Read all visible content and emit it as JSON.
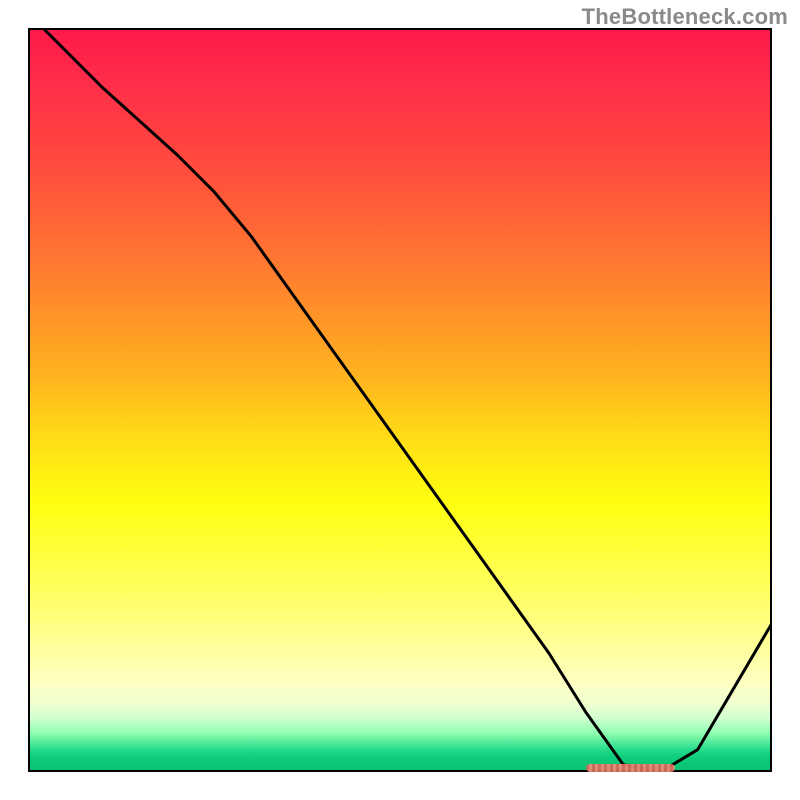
{
  "watermark": "TheBottleneck.com",
  "chart_data": {
    "type": "line",
    "title": "",
    "xlabel": "",
    "ylabel": "",
    "xlim": [
      0,
      100
    ],
    "ylim": [
      0,
      100
    ],
    "x": [
      2,
      10,
      20,
      25,
      30,
      40,
      50,
      60,
      70,
      75,
      80,
      85,
      90,
      100
    ],
    "values": [
      100,
      92,
      83,
      78,
      72,
      58,
      44,
      30,
      16,
      8,
      1,
      0,
      3,
      20
    ],
    "gradient_stops": [
      {
        "pct": 0,
        "color": "#ff1a4a"
      },
      {
        "pct": 6,
        "color": "#ff2a4a"
      },
      {
        "pct": 18,
        "color": "#ff4a3e"
      },
      {
        "pct": 32,
        "color": "#ff7a30"
      },
      {
        "pct": 46,
        "color": "#ffb020"
      },
      {
        "pct": 56,
        "color": "#ffe015"
      },
      {
        "pct": 64,
        "color": "#ffff10"
      },
      {
        "pct": 78,
        "color": "#ffff70"
      },
      {
        "pct": 88,
        "color": "#ffffc0"
      },
      {
        "pct": 91,
        "color": "#f0ffd0"
      },
      {
        "pct": 93,
        "color": "#d0ffd0"
      },
      {
        "pct": 95,
        "color": "#90ffb0"
      },
      {
        "pct": 97,
        "color": "#30e090"
      },
      {
        "pct": 98,
        "color": "#10d080"
      },
      {
        "pct": 100,
        "color": "#0ac070"
      }
    ],
    "valley_marker": {
      "x_start": 75,
      "x_end": 87,
      "y": 0.5,
      "color": "#d46a5a"
    }
  }
}
